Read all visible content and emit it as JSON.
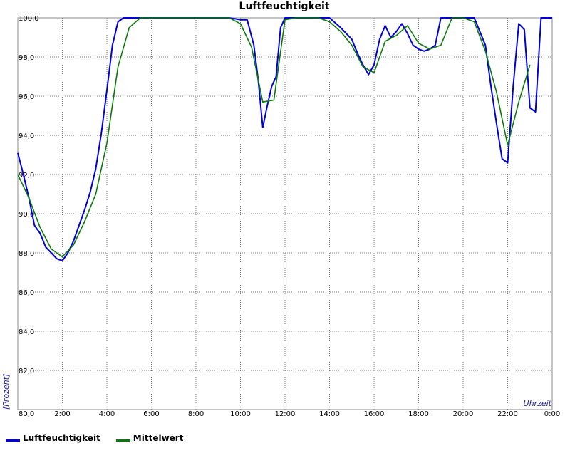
{
  "chart_data": {
    "type": "line",
    "title": "Luftfeuchtigkeit",
    "xlabel": "Uhrzeit",
    "ylabel": "[Prozent]",
    "ylim": [
      80,
      100
    ],
    "xlim": [
      0,
      24
    ],
    "x_tick_labels": [
      "2:00",
      "4:00",
      "6:00",
      "8:00",
      "10:00",
      "12:00",
      "14:00",
      "16:00",
      "18:00",
      "20:00",
      "22:00",
      "0:00"
    ],
    "y_tick_labels": [
      "80,0",
      "82,0",
      "84,0",
      "86,0",
      "88,0",
      "90,0",
      "92,0",
      "94,0",
      "96,0",
      "98,0",
      "100,0"
    ],
    "grid": true,
    "legend_position": "bottom-left",
    "series": [
      {
        "name": "Luftfeuchtigkeit",
        "color": "#0000dd",
        "x": [
          0,
          0.25,
          0.5,
          0.75,
          1,
          1.25,
          1.5,
          1.75,
          2,
          2.25,
          2.5,
          2.75,
          3,
          3.25,
          3.5,
          3.75,
          4,
          4.25,
          4.5,
          4.75,
          5,
          5.25,
          5.5,
          6,
          7,
          8,
          9,
          9.5,
          10,
          10.3,
          10.6,
          10.8,
          11,
          11.2,
          11.4,
          11.6,
          11.8,
          12,
          12.5,
          13,
          13.5,
          14,
          14.5,
          15,
          15.25,
          15.5,
          15.75,
          16,
          16.25,
          16.5,
          16.75,
          17,
          17.25,
          17.5,
          17.75,
          18,
          18.25,
          18.5,
          18.75,
          19,
          19.25,
          19.5,
          20,
          20.5,
          21,
          21.25,
          21.5,
          21.75,
          22,
          22.25,
          22.5,
          22.75,
          23,
          23.25,
          23.5,
          24
        ],
        "y": [
          93.1,
          92.0,
          90.8,
          89.4,
          89.0,
          88.3,
          88.0,
          87.7,
          87.6,
          88.0,
          88.6,
          89.4,
          90.2,
          91.1,
          92.3,
          94.1,
          96.3,
          98.6,
          99.8,
          100,
          100,
          100,
          100,
          100,
          100,
          100,
          100,
          100,
          99.9,
          99.9,
          98.6,
          96.8,
          94.4,
          95.5,
          96.5,
          97.0,
          99.5,
          100,
          100,
          100,
          100,
          100,
          99.5,
          98.9,
          98.2,
          97.6,
          97.1,
          97.6,
          98.9,
          99.6,
          99.0,
          99.3,
          99.7,
          99.2,
          98.6,
          98.4,
          98.3,
          98.4,
          98.6,
          100,
          100,
          100,
          100,
          100,
          98.6,
          96.5,
          94.6,
          92.8,
          92.6,
          96.5,
          99.7,
          99.4,
          95.4,
          95.2,
          100,
          100
        ]
      },
      {
        "name": "Mittelwert",
        "color": "#0a7a0a",
        "x": [
          0,
          0.5,
          1,
          1.5,
          2,
          2.5,
          3,
          3.5,
          4,
          4.5,
          5,
          5.5,
          6,
          7,
          8,
          9,
          9.5,
          10,
          10.5,
          11,
          11.5,
          12,
          12.5,
          13,
          13.5,
          14,
          14.5,
          15,
          15.5,
          16,
          16.5,
          17,
          17.5,
          18,
          18.5,
          19,
          19.5,
          20,
          20.5,
          21,
          21.5,
          22,
          22.5,
          23
        ],
        "y": [
          92.0,
          90.8,
          89.3,
          88.2,
          87.8,
          88.4,
          89.6,
          91.0,
          93.6,
          97.5,
          99.5,
          100,
          100,
          100,
          100,
          100,
          100,
          99.7,
          98.5,
          95.7,
          95.8,
          99.9,
          100,
          100,
          100,
          99.8,
          99.3,
          98.6,
          97.5,
          97.2,
          98.8,
          99.1,
          99.6,
          98.7,
          98.4,
          98.6,
          100,
          100,
          99.8,
          98.3,
          96.2,
          93.5,
          95.7,
          97.6
        ]
      }
    ]
  }
}
